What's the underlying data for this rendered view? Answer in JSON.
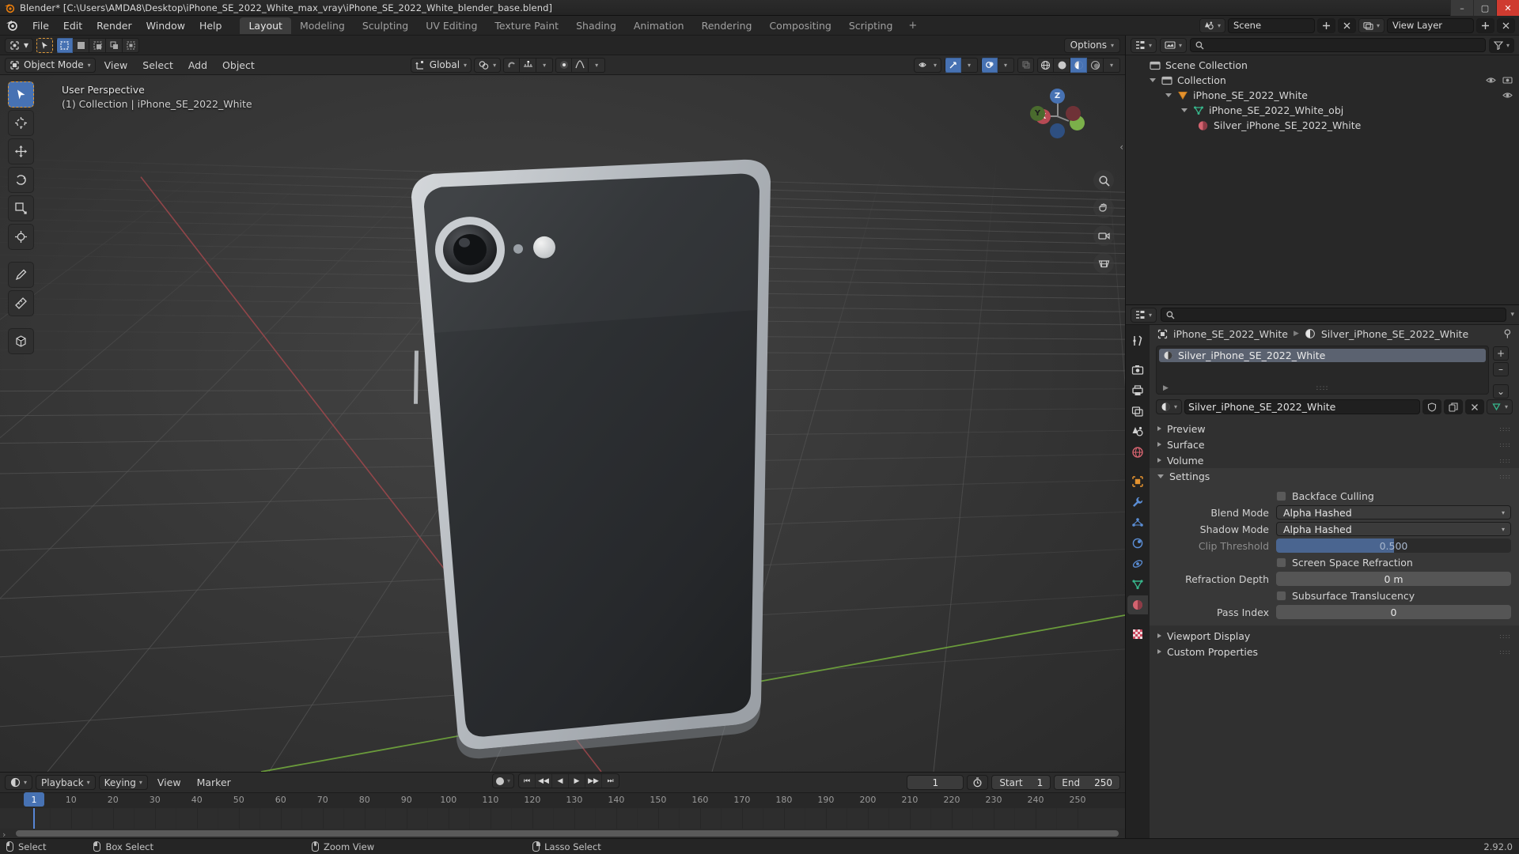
{
  "window": {
    "title": "Blender* [C:\\Users\\AMDA8\\Desktop\\iPhone_SE_2022_White_max_vray\\iPhone_SE_2022_White_blender_base.blend]",
    "minimize": "–",
    "maximize": "▢",
    "close": "✕"
  },
  "topbar": {
    "menus": [
      "File",
      "Edit",
      "Render",
      "Window",
      "Help"
    ],
    "tabs": [
      {
        "label": "Layout",
        "active": true
      },
      {
        "label": "Modeling",
        "active": false
      },
      {
        "label": "Sculpting",
        "active": false
      },
      {
        "label": "UV Editing",
        "active": false
      },
      {
        "label": "Texture Paint",
        "active": false
      },
      {
        "label": "Shading",
        "active": false
      },
      {
        "label": "Animation",
        "active": false
      },
      {
        "label": "Rendering",
        "active": false
      },
      {
        "label": "Compositing",
        "active": false
      },
      {
        "label": "Scripting",
        "active": false
      }
    ],
    "add_tab": "+",
    "scene_name": "Scene",
    "view_layer_name": "View Layer",
    "scene_icon": "scene-icon",
    "view_layer_icon": "view-layer-icon"
  },
  "viewport_header": {
    "mode": "Object Mode",
    "menus": [
      "View",
      "Select",
      "Add",
      "Object"
    ],
    "transform_orientation": "Global",
    "options_label": "Options",
    "overlay_line1": "User Perspective",
    "overlay_line2": "(1) Collection | iPhone_SE_2022_White"
  },
  "gizmo": {
    "axes": [
      {
        "label": "Z",
        "color": "#4772b3"
      },
      {
        "label": "X",
        "color": "#b74a54"
      },
      {
        "label": "Y",
        "color": "#7bb04a"
      }
    ]
  },
  "outliner": {
    "rows": [
      {
        "label": "Scene Collection",
        "indent": 0,
        "icon": "collection-icon",
        "arrow": "none"
      },
      {
        "label": "Collection",
        "indent": 1,
        "icon": "collection-icon",
        "arrow": "down"
      },
      {
        "label": "iPhone_SE_2022_White",
        "indent": 2,
        "icon": "object-mesh-icon",
        "arrow": "down"
      },
      {
        "label": "iPhone_SE_2022_White_obj",
        "indent": 3,
        "icon": "mesh-data-icon",
        "arrow": "down"
      },
      {
        "label": "Silver_iPhone_SE_2022_White",
        "indent": 4,
        "icon": "material-icon",
        "arrow": "none"
      }
    ],
    "search_placeholder": ""
  },
  "properties": {
    "breadcrumb": {
      "object": "iPhone_SE_2022_White",
      "material": "Silver_iPhone_SE_2022_White"
    },
    "material_slots": [
      {
        "name": "Silver_iPhone_SE_2022_White",
        "selected": true
      }
    ],
    "material_name": "Silver_iPhone_SE_2022_White",
    "slot_buttons": [
      "+",
      "–",
      "⌄"
    ],
    "panels": [
      {
        "label": "Preview",
        "open": false
      },
      {
        "label": "Surface",
        "open": false
      },
      {
        "label": "Volume",
        "open": false
      },
      {
        "label": "Settings",
        "open": true
      }
    ],
    "settings": {
      "backface_culling": {
        "label": "Backface Culling",
        "checked": false
      },
      "blend_mode": {
        "label": "Blend Mode",
        "value": "Alpha Hashed"
      },
      "shadow_mode": {
        "label": "Shadow Mode",
        "value": "Alpha Hashed"
      },
      "clip_threshold": {
        "label": "Clip Threshold",
        "value": "0.500",
        "fill_percent": 50
      },
      "screen_space_refraction": {
        "label": "Screen Space Refraction",
        "checked": false
      },
      "refraction_depth": {
        "label": "Refraction Depth",
        "value": "0 m"
      },
      "subsurface_translucency": {
        "label": "Subsurface Translucency",
        "checked": false
      },
      "pass_index": {
        "label": "Pass Index",
        "value": "0"
      }
    },
    "trailing_panels": [
      {
        "label": "Viewport Display",
        "open": false
      },
      {
        "label": "Custom Properties",
        "open": false
      }
    ]
  },
  "timeline": {
    "menus": [
      "View",
      "Marker"
    ],
    "playback": "Playback",
    "keying": "Keying",
    "current_frame": "1",
    "start_label": "Start",
    "start_value": "1",
    "end_label": "End",
    "end_value": "250",
    "ticks": [
      1,
      10,
      20,
      30,
      40,
      50,
      60,
      70,
      80,
      90,
      100,
      110,
      120,
      130,
      140,
      150,
      160,
      170,
      180,
      190,
      200,
      210,
      220,
      230,
      240,
      250
    ],
    "playhead_frame": 1
  },
  "statusbar": {
    "items": [
      {
        "label": "Select",
        "mouse": "left"
      },
      {
        "label": "Box Select",
        "mouse": "left-drag"
      },
      {
        "label": "Zoom View",
        "mouse": "middle"
      },
      {
        "label": "Lasso Select",
        "mouse": "right-drag"
      }
    ],
    "version": "2.92.0"
  },
  "colors": {
    "accent_blue": "#4772b3",
    "highlight_orange": "#e09b3a",
    "panel_bg": "#303030",
    "header_bg": "#2b2b2b"
  }
}
